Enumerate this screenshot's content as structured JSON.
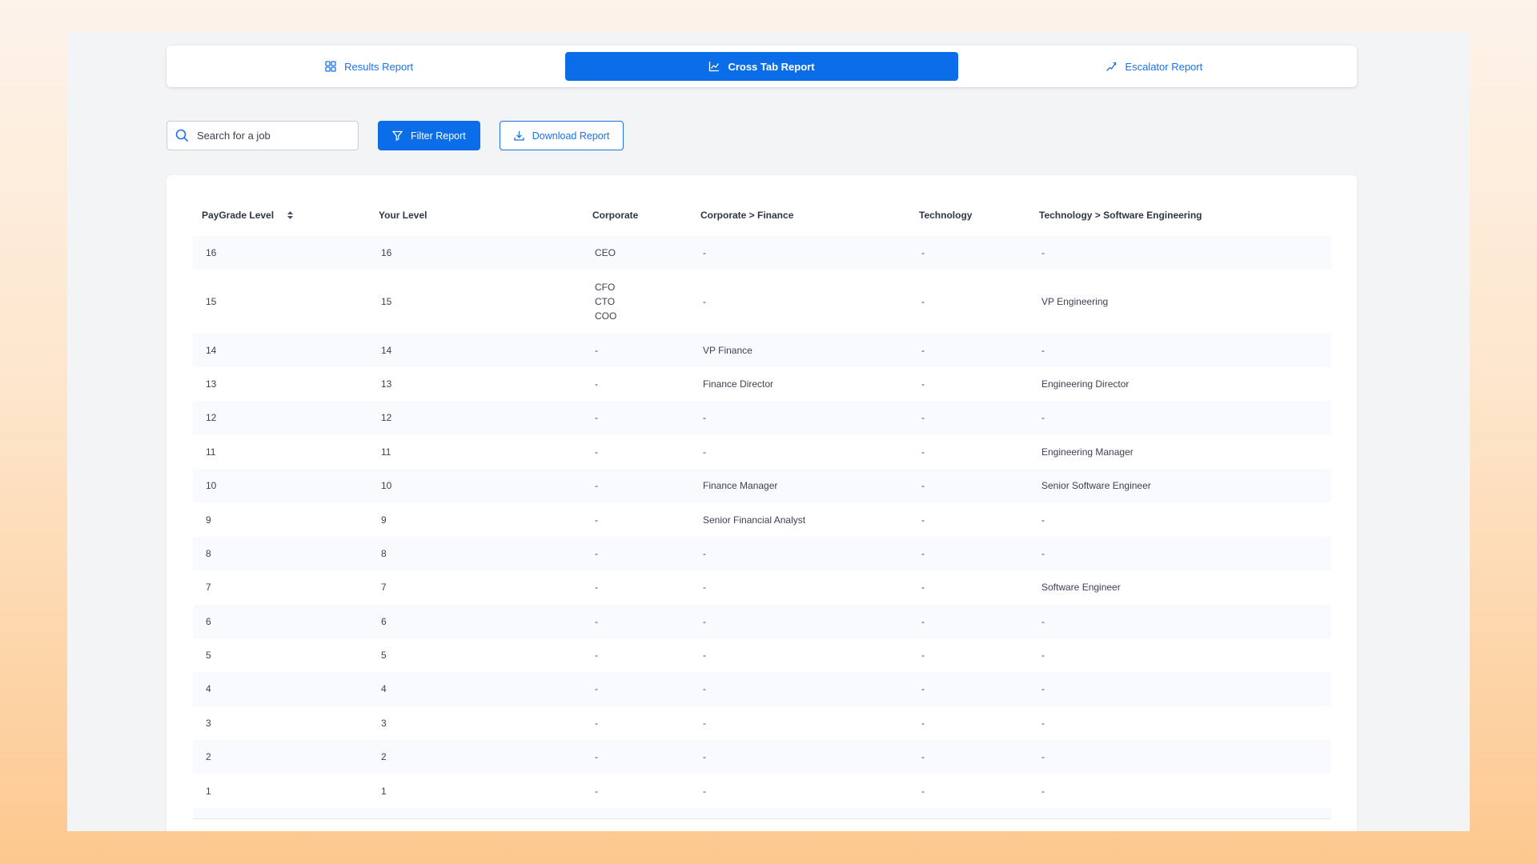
{
  "tabs": [
    {
      "label": "Results Report",
      "icon": "grid-icon",
      "active": false
    },
    {
      "label": "Cross Tab Report",
      "icon": "chart-icon",
      "active": true
    },
    {
      "label": "Escalator Report",
      "icon": "trend-icon",
      "active": false
    }
  ],
  "toolbar": {
    "search_placeholder": "Search for a job",
    "filter_label": "Filter Report",
    "download_label": "Download Report"
  },
  "table": {
    "headers": [
      "PayGrade Level",
      "Your Level",
      "Corporate",
      "Corporate > Finance",
      "Technology",
      "Technology > Software Engineering"
    ],
    "rows": [
      [
        "16",
        "16",
        "CEO",
        "-",
        "-",
        "-"
      ],
      [
        "15",
        "15",
        "CFO|CTO|COO",
        "-",
        "-",
        "VP Engineering"
      ],
      [
        "14",
        "14",
        "-",
        "VP Finance",
        "-",
        "-"
      ],
      [
        "13",
        "13",
        "-",
        "Finance Director",
        "-",
        "Engineering Director"
      ],
      [
        "12",
        "12",
        "-",
        "-",
        "-",
        "-"
      ],
      [
        "11",
        "11",
        "-",
        "-",
        "-",
        "Engineering Manager"
      ],
      [
        "10",
        "10",
        "-",
        "Finance Manager",
        "-",
        "Senior Software Engineer"
      ],
      [
        "9",
        "9",
        "-",
        "Senior Financial Analyst",
        "-",
        "-"
      ],
      [
        "8",
        "8",
        "-",
        "-",
        "-",
        "-"
      ],
      [
        "7",
        "7",
        "-",
        "-",
        "-",
        "Software Engineer"
      ],
      [
        "6",
        "6",
        "-",
        "-",
        "-",
        "-"
      ],
      [
        "5",
        "5",
        "-",
        "-",
        "-",
        "-"
      ],
      [
        "4",
        "4",
        "-",
        "-",
        "-",
        "-"
      ],
      [
        "3",
        "3",
        "-",
        "-",
        "-",
        "-"
      ],
      [
        "2",
        "2",
        "-",
        "-",
        "-",
        "-"
      ],
      [
        "1",
        "1",
        "-",
        "-",
        "-",
        "-"
      ]
    ]
  },
  "colors": {
    "accent": "#0b6ee8",
    "stripe": "#f8fafd"
  }
}
